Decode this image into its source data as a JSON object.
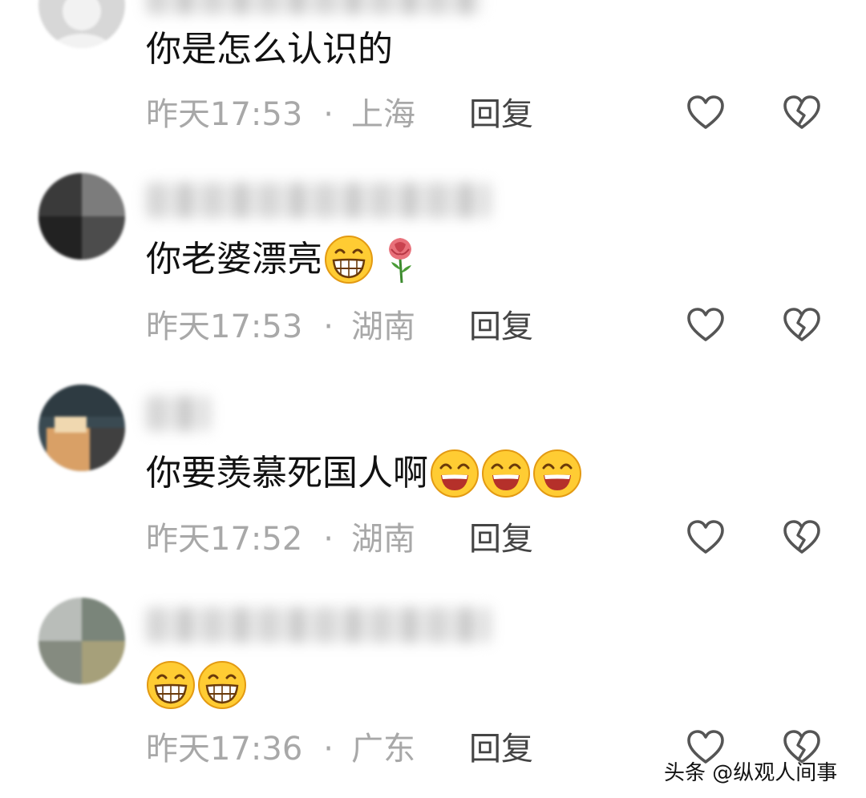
{
  "comments": [
    {
      "text": "你是怎么认识的",
      "time": "昨天17:53",
      "location": "上海",
      "reply": "回复",
      "emojis": []
    },
    {
      "text": "你老婆漂亮",
      "time": "昨天17:53",
      "location": "湖南",
      "reply": "回复",
      "emojis": [
        "grin-emoji",
        "rose-emoji"
      ]
    },
    {
      "text": "你要羡慕死国人啊",
      "time": "昨天17:52",
      "location": "湖南",
      "reply": "回复",
      "emojis": [
        "smile-emoji",
        "smile-emoji",
        "smile-emoji"
      ]
    },
    {
      "text": "",
      "time": "昨天17:36",
      "location": "广东",
      "reply": "回复",
      "emojis": [
        "grin-emoji",
        "grin-emoji"
      ]
    }
  ],
  "separator": "·",
  "watermark": "头条 @纵观人间事",
  "icons": {
    "like": "heart-outline-icon",
    "dislike": "broken-heart-icon"
  },
  "colors": {
    "meta": "#a8a8a8",
    "reply": "#444444",
    "icon": "#555555"
  }
}
